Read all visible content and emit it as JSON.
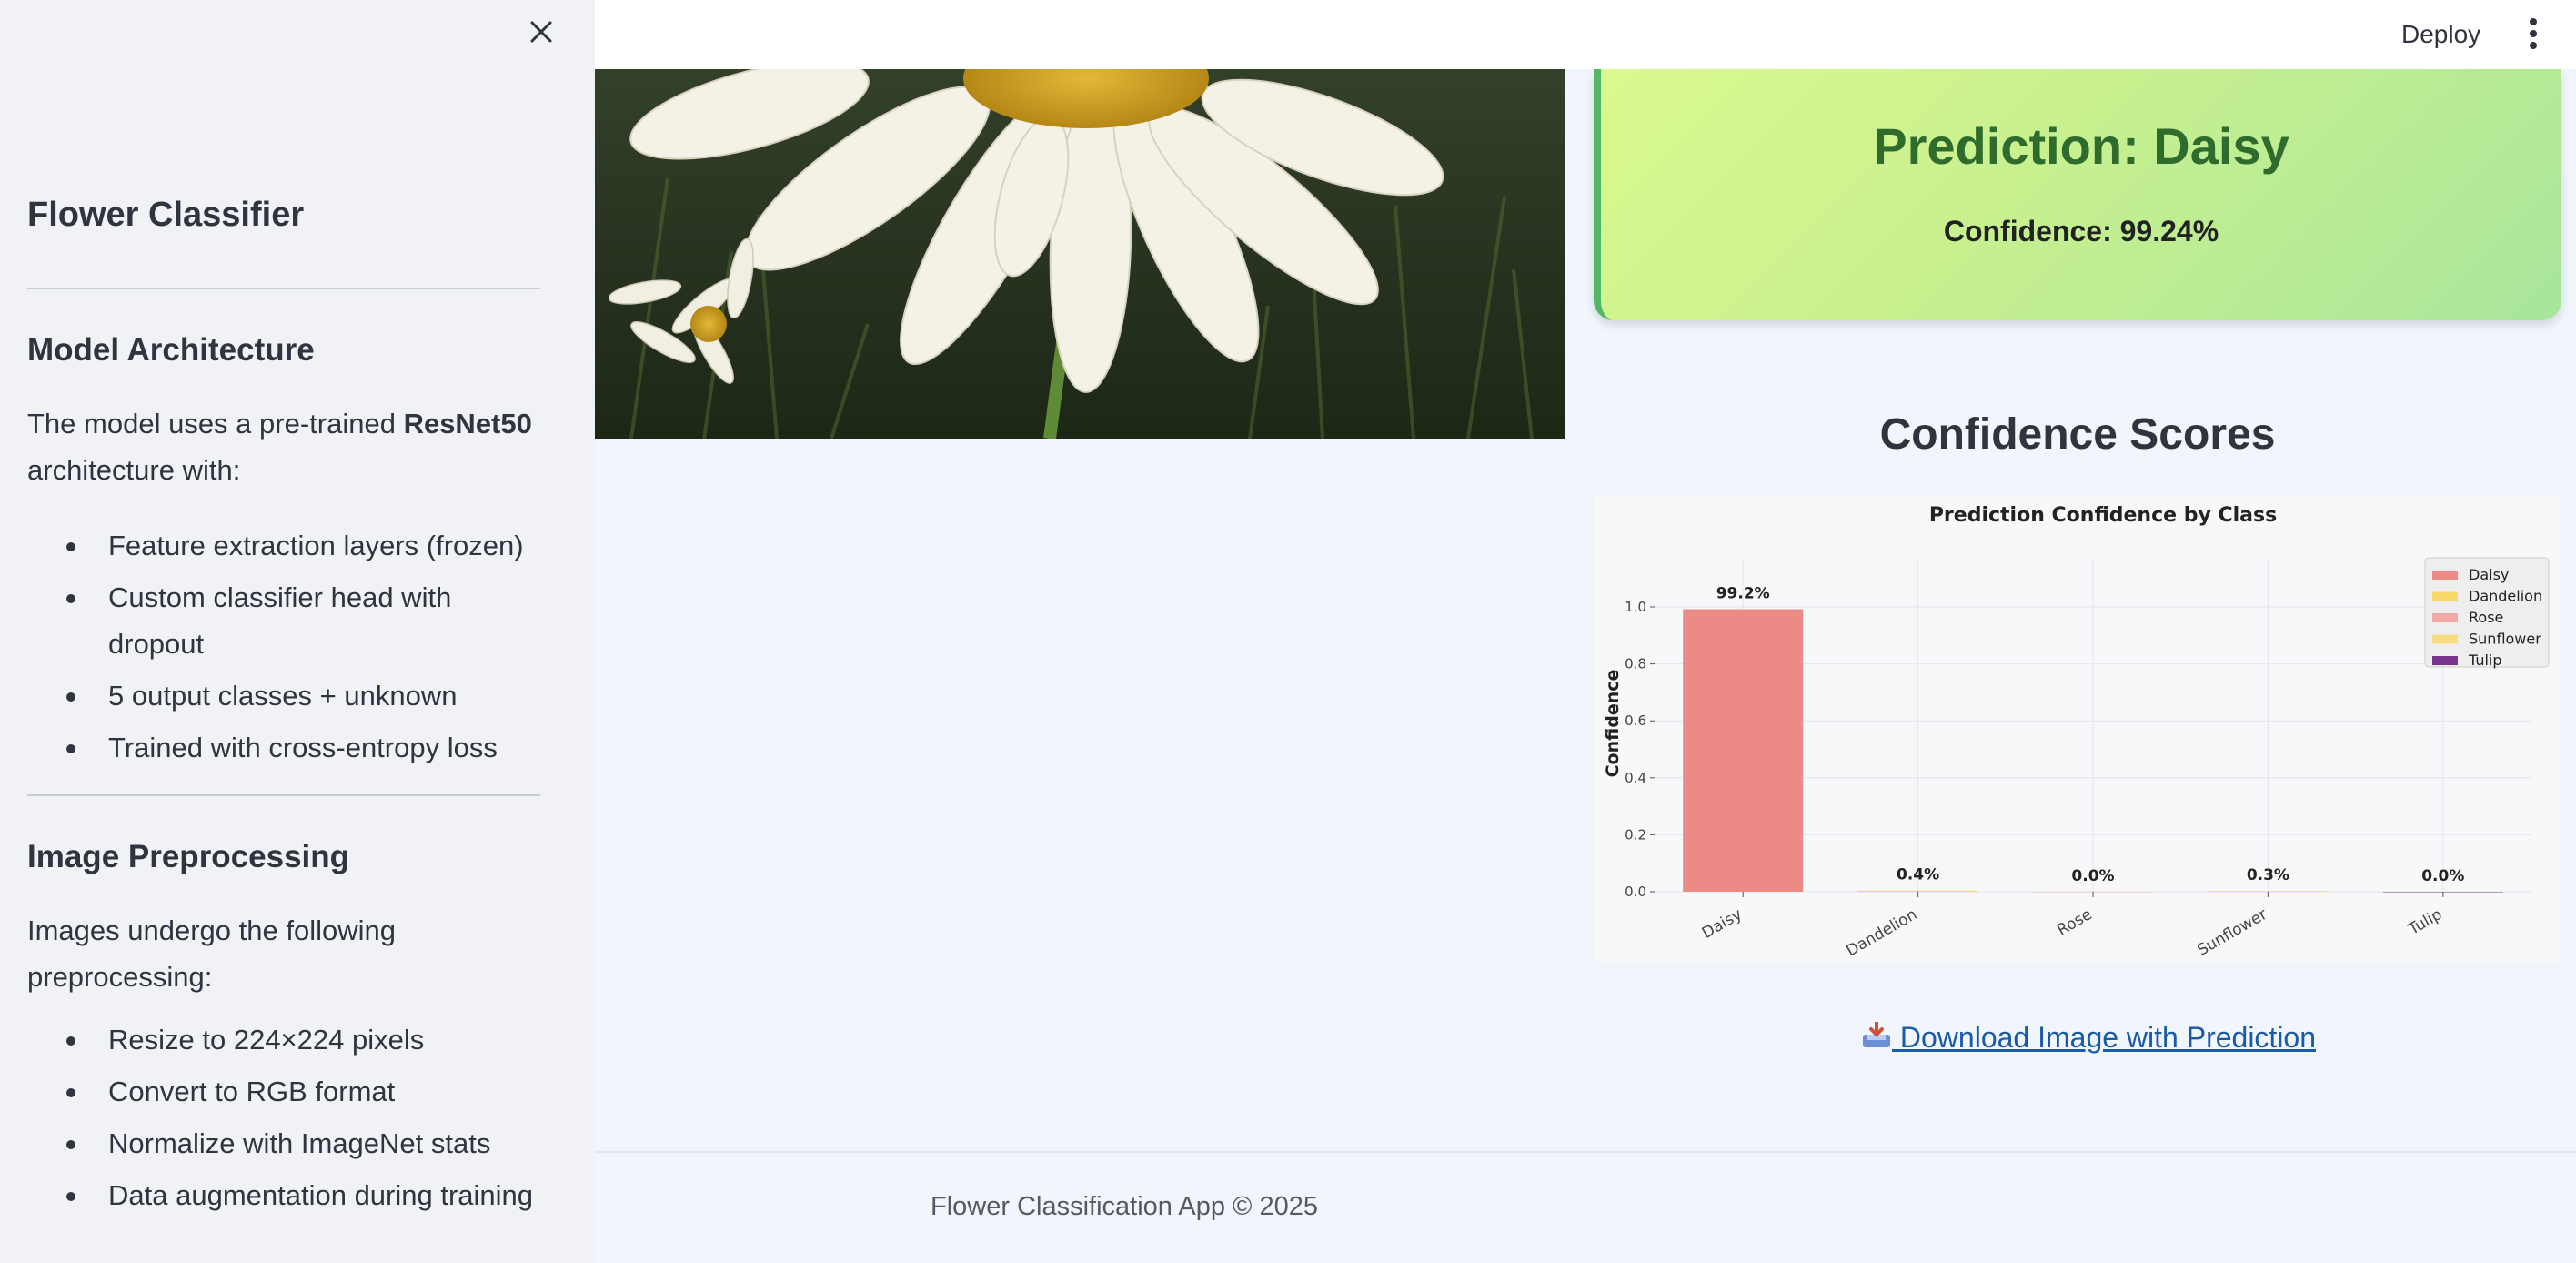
{
  "sidebar": {
    "title": "Flower Classifier",
    "close_icon": "close-icon",
    "sections": [
      {
        "heading": "Model Architecture",
        "intro_before": "The model uses a pre-trained ",
        "intro_bold": "ResNet50",
        "intro_after": " architecture with:",
        "items": [
          "Feature extraction layers (frozen)",
          "Custom classifier head with dropout",
          "5 output classes + unknown",
          "Trained with cross-entropy loss"
        ]
      },
      {
        "heading": "Image Preprocessing",
        "intro": "Images undergo the following preprocessing:",
        "items": [
          "Resize to 224×224 pixels",
          "Convert to RGB format",
          "Normalize with ImageNet stats",
          "Data augmentation during training"
        ]
      }
    ]
  },
  "header": {
    "deploy_label": "Deploy",
    "menu_icon": "more-vert-icon"
  },
  "prediction": {
    "title": "Prediction: Daisy",
    "confidence": "Confidence: 99.24%"
  },
  "scores": {
    "title": "Confidence Scores"
  },
  "chart_data": {
    "type": "bar",
    "title": "Prediction Confidence by Class",
    "xlabel": "",
    "ylabel": "Confidence",
    "categories": [
      "Daisy",
      "Dandelion",
      "Rose",
      "Sunflower",
      "Tulip"
    ],
    "values": [
      0.992,
      0.004,
      0.0,
      0.003,
      0.0
    ],
    "data_labels": [
      "99.2%",
      "0.4%",
      "0.0%",
      "0.3%",
      "0.0%"
    ],
    "colors": [
      "#ec8b86",
      "#f6d86b",
      "#f0a9a4",
      "#f8dc82",
      "#7a3590"
    ],
    "yticks": [
      "0.0",
      "0.2",
      "0.4",
      "0.6",
      "0.8",
      "1.0"
    ],
    "ylim": [
      0,
      1.0
    ],
    "legend": [
      "Daisy",
      "Dandelion",
      "Rose",
      "Sunflower",
      "Tulip"
    ],
    "legend_position": "top-right",
    "grid": true
  },
  "download": {
    "icon": "inbox-tray-icon",
    "label": "Download Image with Prediction"
  },
  "footer": {
    "text": "Flower Classification App © 2025"
  }
}
